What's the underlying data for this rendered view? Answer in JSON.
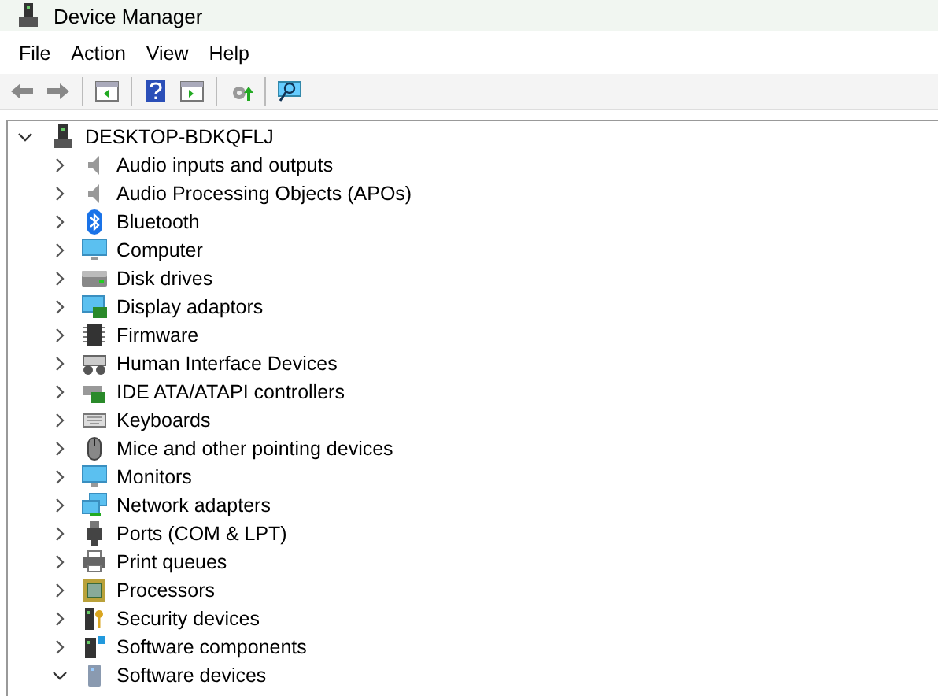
{
  "window": {
    "title": "Device Manager"
  },
  "menu": [
    "File",
    "Action",
    "View",
    "Help"
  ],
  "tree": {
    "label": "DESKTOP-BDKQFLJ",
    "expanded": true,
    "children": [
      {
        "label": "Audio inputs and outputs",
        "expanded": false
      },
      {
        "label": "Audio Processing Objects (APOs)",
        "expanded": false
      },
      {
        "label": "Bluetooth",
        "expanded": false
      },
      {
        "label": "Computer",
        "expanded": false
      },
      {
        "label": "Disk drives",
        "expanded": false
      },
      {
        "label": "Display adaptors",
        "expanded": false
      },
      {
        "label": "Firmware",
        "expanded": false
      },
      {
        "label": "Human Interface Devices",
        "expanded": false
      },
      {
        "label": "IDE ATA/ATAPI controllers",
        "expanded": false
      },
      {
        "label": "Keyboards",
        "expanded": false
      },
      {
        "label": "Mice and other pointing devices",
        "expanded": false
      },
      {
        "label": "Monitors",
        "expanded": false
      },
      {
        "label": "Network adapters",
        "expanded": false
      },
      {
        "label": "Ports (COM & LPT)",
        "expanded": false
      },
      {
        "label": "Print queues",
        "expanded": false
      },
      {
        "label": "Processors",
        "expanded": false
      },
      {
        "label": "Security devices",
        "expanded": false
      },
      {
        "label": "Software components",
        "expanded": false
      },
      {
        "label": "Software devices",
        "expanded": true
      }
    ]
  }
}
